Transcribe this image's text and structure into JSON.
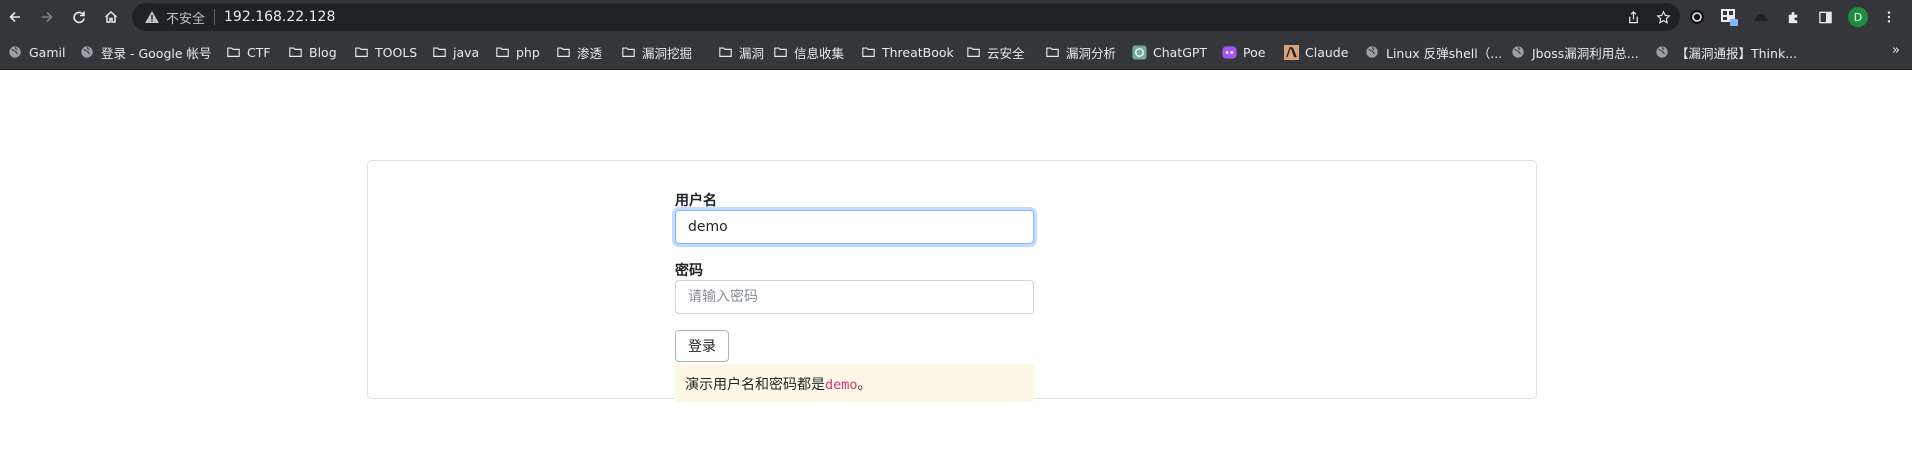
{
  "browser": {
    "insecure_label": "不安全",
    "url": "192.168.22.128",
    "profile_initial": "D",
    "bookmarks": [
      {
        "label": "Gamil",
        "icon": "globe-icon"
      },
      {
        "label": "登录 - Google 帐号",
        "icon": "globe-icon"
      },
      {
        "label": "CTF",
        "icon": "folder-icon"
      },
      {
        "label": "Blog",
        "icon": "folder-icon"
      },
      {
        "label": "TOOLS",
        "icon": "folder-icon"
      },
      {
        "label": "java",
        "icon": "folder-icon"
      },
      {
        "label": "php",
        "icon": "folder-icon"
      },
      {
        "label": "渗透",
        "icon": "folder-icon"
      },
      {
        "label": "漏洞挖掘",
        "icon": "folder-icon"
      },
      {
        "label": "漏洞",
        "icon": "folder-icon"
      },
      {
        "label": "信息收集",
        "icon": "folder-icon"
      },
      {
        "label": "ThreatBook",
        "icon": "folder-icon"
      },
      {
        "label": "云安全",
        "icon": "folder-icon"
      },
      {
        "label": "漏洞分析",
        "icon": "folder-icon"
      },
      {
        "label": "ChatGPT",
        "icon": "chatgpt-icon"
      },
      {
        "label": "Poe",
        "icon": "poe-icon"
      },
      {
        "label": "Claude",
        "icon": "claude-icon"
      },
      {
        "label": "Linux 反弹shell（...",
        "icon": "globe-icon"
      },
      {
        "label": "Jboss漏洞利用总...",
        "icon": "globe-icon"
      },
      {
        "label": "【漏洞通报】Think...",
        "icon": "globe-icon"
      }
    ],
    "more_label": "»"
  },
  "login": {
    "username_label": "用户名",
    "username_value": "demo",
    "password_label": "密码",
    "password_placeholder": "请输入密码",
    "submit_label": "登录",
    "notice_text": "演示用户名和密码都是",
    "notice_code": "demo",
    "notice_end": "。"
  }
}
